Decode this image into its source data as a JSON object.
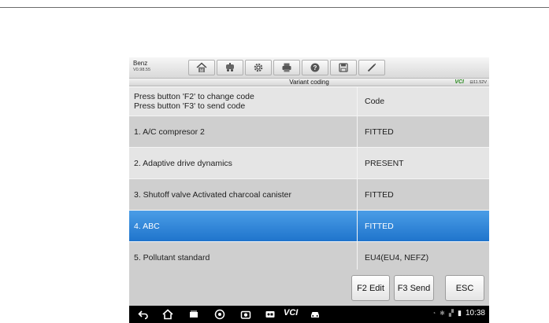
{
  "header": {
    "make": "Benz",
    "version": "V0.98.55",
    "toolbar": [
      {
        "icon": "home-icon"
      },
      {
        "icon": "vehicle-swap-icon"
      },
      {
        "icon": "gear-icon"
      },
      {
        "icon": "print-icon"
      },
      {
        "icon": "help-icon"
      },
      {
        "icon": "save-icon"
      },
      {
        "icon": "pen-icon"
      }
    ]
  },
  "titlebar": {
    "title": "Variant coding",
    "vci": "VCI",
    "battery": "11.52V"
  },
  "table": {
    "instruction_line1": "Press button 'F2' to change code",
    "instruction_line2": "Press button 'F3' to send code",
    "code_header": "Code",
    "rows": [
      {
        "label": "1. A/C compresor 2",
        "value": "FITTED",
        "selected": false
      },
      {
        "label": "2. Adaptive drive dynamics",
        "value": "PRESENT",
        "selected": false
      },
      {
        "label": "3. Shutoff valve Activated charcoal canister",
        "value": "FITTED",
        "selected": false
      },
      {
        "label": "4. ABC",
        "value": "FITTED",
        "selected": true
      },
      {
        "label": "5. Pollutant standard",
        "value": "EU4(EU4, NEFZ)",
        "selected": false
      }
    ]
  },
  "footer": {
    "f2_label": "F2 Edit",
    "f3_label": "F3 Send",
    "esc_label": "ESC"
  },
  "navbar": {
    "vci_label": "VCI",
    "time": "10:38"
  },
  "colors": {
    "selected_row": "#1f74cc",
    "odd_row": "#e5e5e5",
    "even_row": "#cfcfcf",
    "vci_green": "#2a8a1f"
  }
}
